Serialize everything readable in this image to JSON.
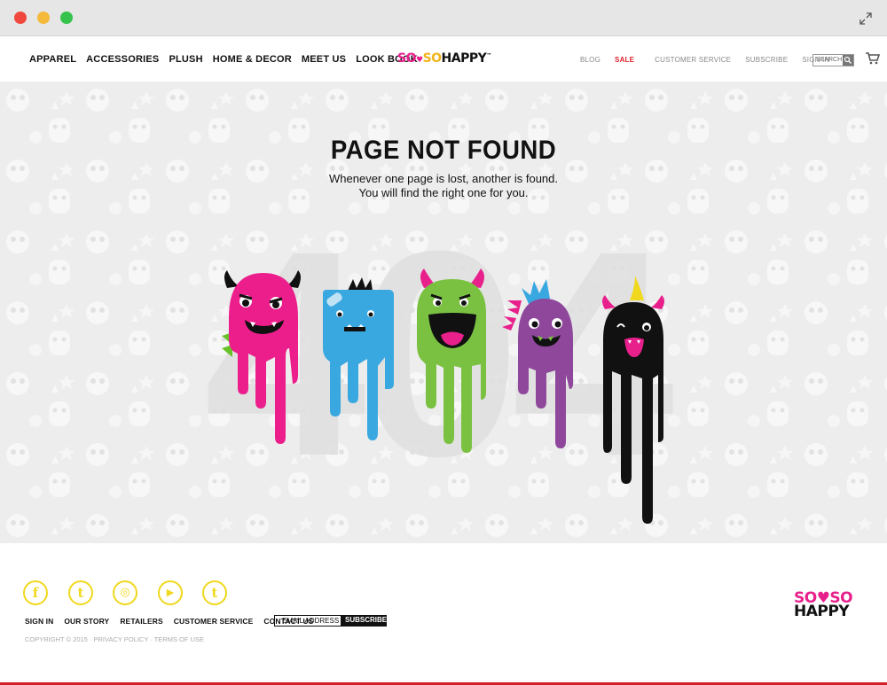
{
  "header": {
    "nav_left": [
      "APPAREL",
      "ACCESSORIES",
      "PLUSH",
      "HOME & DECOR",
      "MEET US",
      "LOOK BOOK"
    ],
    "logo": {
      "so1": "SO",
      "so2": "SO",
      "happy": "HAPPY",
      "tm": "™"
    },
    "nav_right": {
      "blog": "BLOG",
      "sale": "SALE",
      "customer_service": "CUSTOMER SERVICE",
      "subscribe": "SUBSCRIBE",
      "sign_in": "SIGN IN"
    },
    "search_placeholder": "SEARCH"
  },
  "main": {
    "title": "PAGE NOT FOUND",
    "subtitle_line1": "Whenever one page is lost, another is found.",
    "subtitle_line2": "You will find the right one for you.",
    "background_number": "404"
  },
  "footer": {
    "social_icons": [
      "facebook-icon",
      "twitter-icon",
      "instagram-icon",
      "youtube-icon",
      "tumblr-icon"
    ],
    "social_glyphs": [
      "f",
      "t",
      "◎",
      "▶",
      "t"
    ],
    "links": [
      "SIGN IN",
      "OUR STORY",
      "RETAILERS",
      "CUSTOMER SERVICE",
      "CONTACT US"
    ],
    "email_placeholder": "EMAIL ADDRESS",
    "subscribe_label": "SUBSCRIBE",
    "copyright": "COPYRIGHT © 2015  ·  PRIVACY POLICY  ·  TERMS OF USE",
    "logo_line1": "SO♥SO",
    "logo_line2": "HAPPY"
  },
  "colors": {
    "brand_pink": "#e8208c",
    "brand_yellow": "#f0d81e",
    "brand_green": "#6ac22b",
    "sale_red": "#e0202a",
    "monster_pink": "#ec1e8c",
    "monster_blue": "#3aa8e0",
    "monster_green": "#7ac141",
    "monster_purple": "#8e479b",
    "monster_black": "#111111"
  }
}
